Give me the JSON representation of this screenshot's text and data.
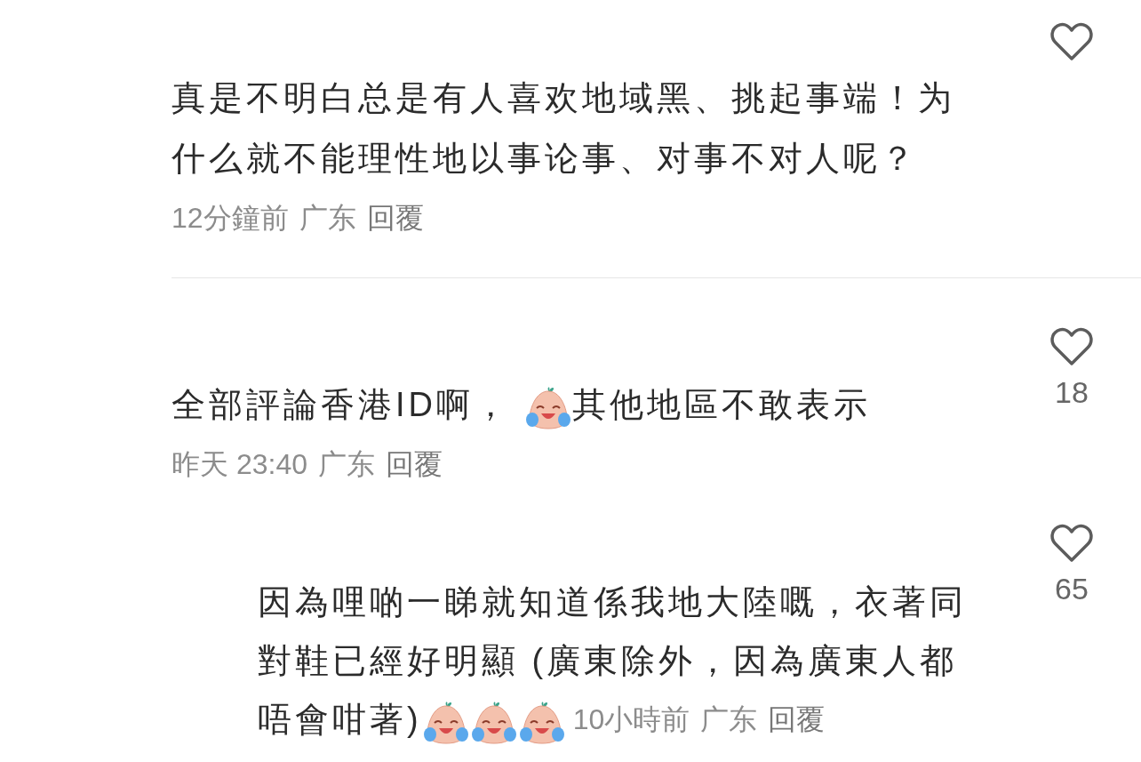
{
  "comments": [
    {
      "lines": [
        [
          {
            "kind": "text",
            "text": "真是不明白总是有人喜欢地域黑、挑起事端！为"
          }
        ],
        [
          {
            "kind": "text",
            "text": "什么就不能理性地以事论事、对事不对人呢？"
          }
        ]
      ],
      "time": "12分鐘前",
      "location": "广东",
      "reply_label": "回覆"
    },
    {
      "lines": [
        [
          {
            "kind": "text",
            "text": "全部評論香港ID啊， "
          },
          {
            "kind": "emoji"
          },
          {
            "kind": "text",
            "text": "其他地區不敢表示"
          }
        ]
      ],
      "time": "昨天 23:40",
      "location": "广东",
      "reply_label": "回覆",
      "likes": "18",
      "children": [
        {
          "lines": [
            [
              {
                "kind": "text",
                "text": "因為哩啲一睇就知道係我地大陸嘅，衣著同"
              }
            ],
            [
              {
                "kind": "text",
                "text": "對鞋已經好明顯 (廣東除外，因為廣東人都"
              }
            ],
            [
              {
                "kind": "text",
                "text": "唔會咁著)"
              },
              {
                "kind": "emoji"
              },
              {
                "kind": "emoji"
              },
              {
                "kind": "emoji"
              }
            ]
          ],
          "time": "10小時前",
          "location": "广东",
          "reply_label": "回覆",
          "likes": "65"
        }
      ]
    }
  ]
}
